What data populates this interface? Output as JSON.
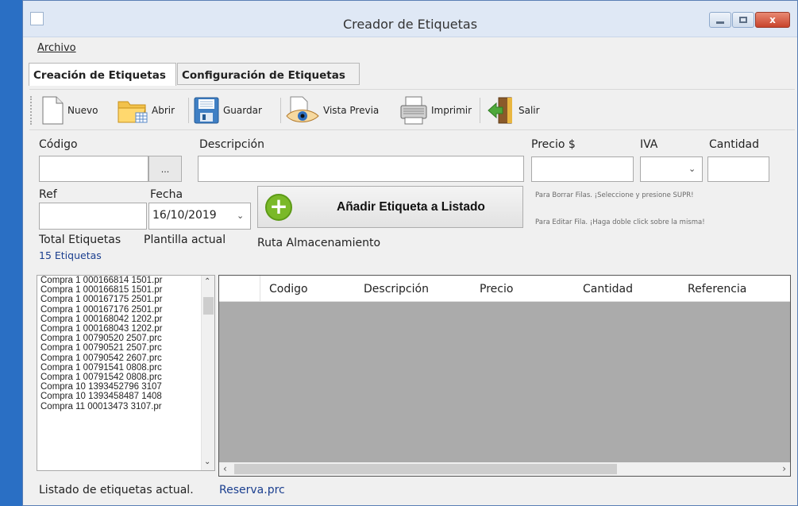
{
  "window": {
    "title": "Creador de Etiquetas",
    "icon": "app-window-icon",
    "controls": {
      "minimize": "minimize-icon",
      "maximize": "maximize-icon",
      "close": "x"
    }
  },
  "menu": {
    "archivo": "Archivo"
  },
  "tabs": [
    {
      "label": "Creación de Etiquetas",
      "active": true
    },
    {
      "label": "Configuración de Etiquetas",
      "active": false
    }
  ],
  "toolbar": {
    "nuevo": "Nuevo",
    "abrir": "Abrir",
    "guardar": "Guardar",
    "vista_previa": "Vista Previa",
    "imprimir": "Imprimir",
    "salir": "Salir"
  },
  "form": {
    "codigo_label": "Código",
    "codigo_value": "",
    "browse_button": "...",
    "descripcion_label": "Descripción",
    "descripcion_value": "",
    "precio_label": "Precio $",
    "precio_value": "",
    "iva_label": "IVA",
    "iva_value": "",
    "cantidad_label": "Cantidad",
    "cantidad_value": "",
    "ref_label": "Ref",
    "ref_value": "",
    "fecha_label": "Fecha",
    "fecha_value": "16/10/2019",
    "add_button": "Añadir Etiqueta a Listado",
    "hint_borrar": "Para Borrar Filas. ¡Seleccione y presione SUPR!",
    "hint_editar": "Para Editar Fila. ¡Haga doble click sobre la misma!"
  },
  "info": {
    "total_label": "Total Etiquetas",
    "total_value": "15 Etiquetas",
    "plantilla_label": "Plantilla actual",
    "ruta_label": "Ruta Almacenamiento"
  },
  "files": [
    "Compra 1 000166814 1501.pr",
    "Compra 1 000166815 1501.pr",
    "Compra 1 000167175 2501.pr",
    "Compra 1 000167176 2501.pr",
    "Compra 1 000168042 1202.pr",
    "Compra 1 000168043 1202.pr",
    "Compra 1 00790520 2507.prc",
    "Compra 1 00790521 2507.prc",
    "Compra 1 00790542 2607.prc",
    "Compra 1 00791541 0808.prc",
    "Compra 1 00791542 0808.prc",
    "Compra 10 1393452796 3107",
    "Compra 10 1393458487 1408",
    "Compra 11 00013473 3107.pr"
  ],
  "grid": {
    "columns": [
      "Codigo",
      "Descripción",
      "Precio",
      "Cantidad",
      "Referencia"
    ],
    "rows": []
  },
  "footer": {
    "label": "Listado de etiquetas actual.",
    "file": "Reserva.prc"
  }
}
